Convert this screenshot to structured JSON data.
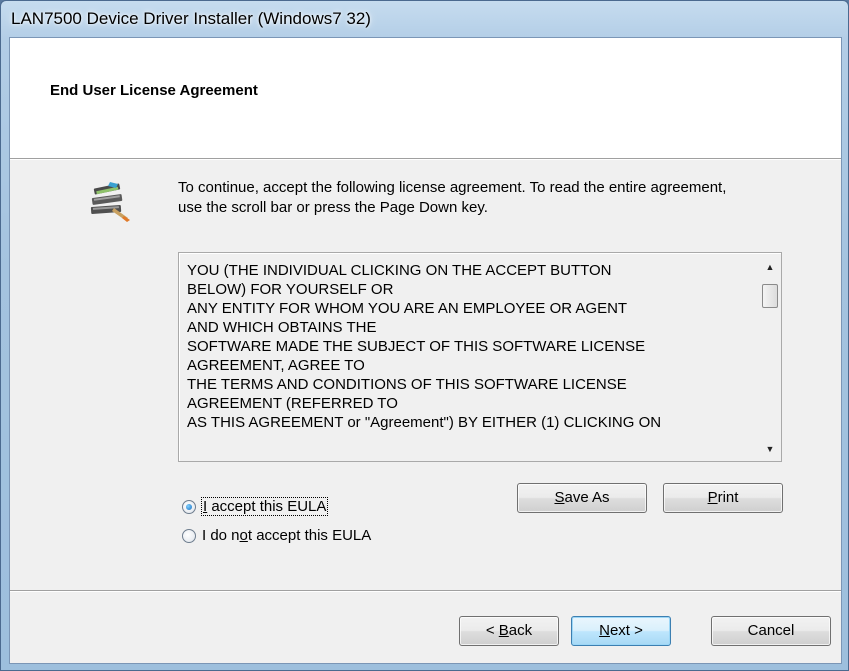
{
  "window": {
    "title": "LAN7500 Device Driver Installer (Windows7 32)"
  },
  "header": {
    "title": "End User License Agreement"
  },
  "body": {
    "icon": "setup-wizard-icon",
    "instruction": "To continue, accept the following license agreement. To read the entire agreement, use the scroll bar or press the Page Down key."
  },
  "license": {
    "lines": [
      "YOU (THE INDIVIDUAL CLICKING ON THE ACCEPT BUTTON",
      "BELOW) FOR YOURSELF OR",
      "ANY ENTITY FOR WHOM YOU ARE AN EMPLOYEE OR AGENT",
      "AND WHICH OBTAINS THE",
      "SOFTWARE MADE THE SUBJECT OF THIS SOFTWARE LICENSE",
      "AGREEMENT, AGREE TO",
      "THE TERMS AND CONDITIONS OF THIS SOFTWARE LICENSE",
      "AGREEMENT (REFERRED TO",
      "AS THIS AGREEMENT or \"Agreement\") BY EITHER (1) CLICKING ON"
    ],
    "scroll_up_icon": "scroll-up-arrow",
    "scroll_down_icon": "scroll-down-arrow"
  },
  "options": {
    "accept": {
      "pre": "",
      "key": "I",
      "post": " accept this EULA",
      "selected": true
    },
    "decline": {
      "pre": "I do n",
      "key": "o",
      "post": "t accept this EULA",
      "selected": false
    }
  },
  "buttons": {
    "save_as": {
      "pre": "",
      "key": "S",
      "post": "ave As"
    },
    "print": {
      "pre": "",
      "key": "P",
      "post": "rint"
    },
    "back": {
      "pre": "< ",
      "key": "B",
      "post": "ack"
    },
    "next": {
      "pre": "",
      "key": "N",
      "post": "ext >"
    },
    "cancel": {
      "pre": "",
      "key": "",
      "post": "Cancel"
    }
  },
  "colors": {
    "default_button_border": "#3c7fb1",
    "dialog_background": "#f0f0f0",
    "header_background": "#ffffff"
  }
}
